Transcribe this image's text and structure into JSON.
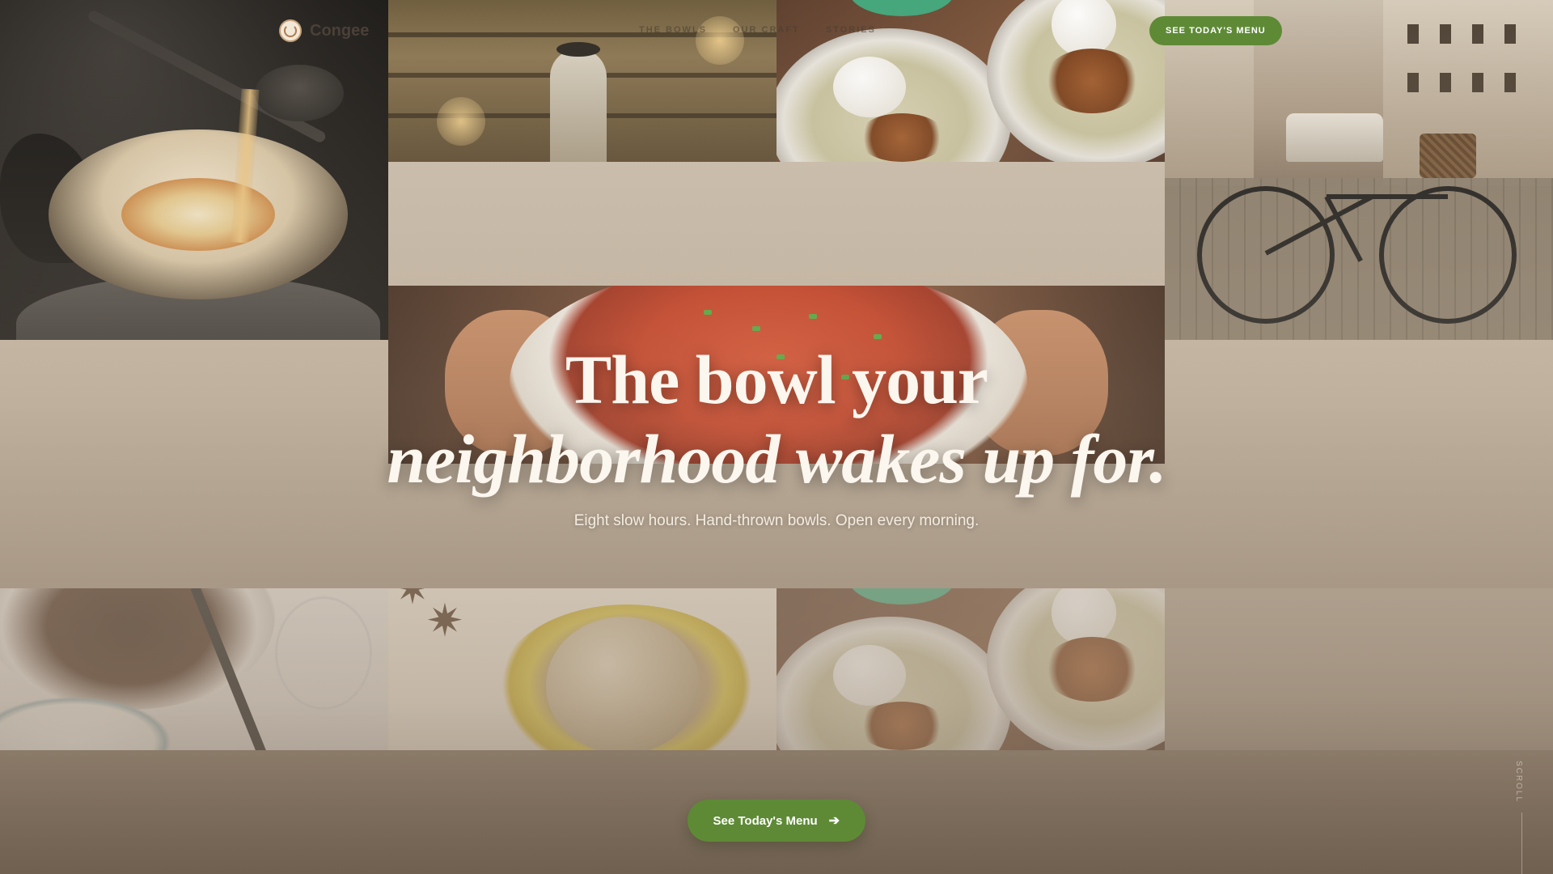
{
  "brand": {
    "name": "Congee"
  },
  "nav": {
    "links": [
      "THE BOWLS",
      "OUR CRAFT",
      "STORIES"
    ],
    "cta_label": "SEE TODAY'S MENU"
  },
  "hero": {
    "headline_line1": "The bowl your",
    "headline_line2": "neighborhood wakes up for.",
    "subheading": "Eight slow hours. Hand-thrown bowls. Open every morning.",
    "cta_label": "See Today's Menu",
    "cta_icon": "arrow-right-icon"
  },
  "scroll_hint": "SCROLL",
  "colors": {
    "accent": "#5e8a36",
    "headline": "#fbf6ee",
    "background": "#c4b6a3"
  }
}
